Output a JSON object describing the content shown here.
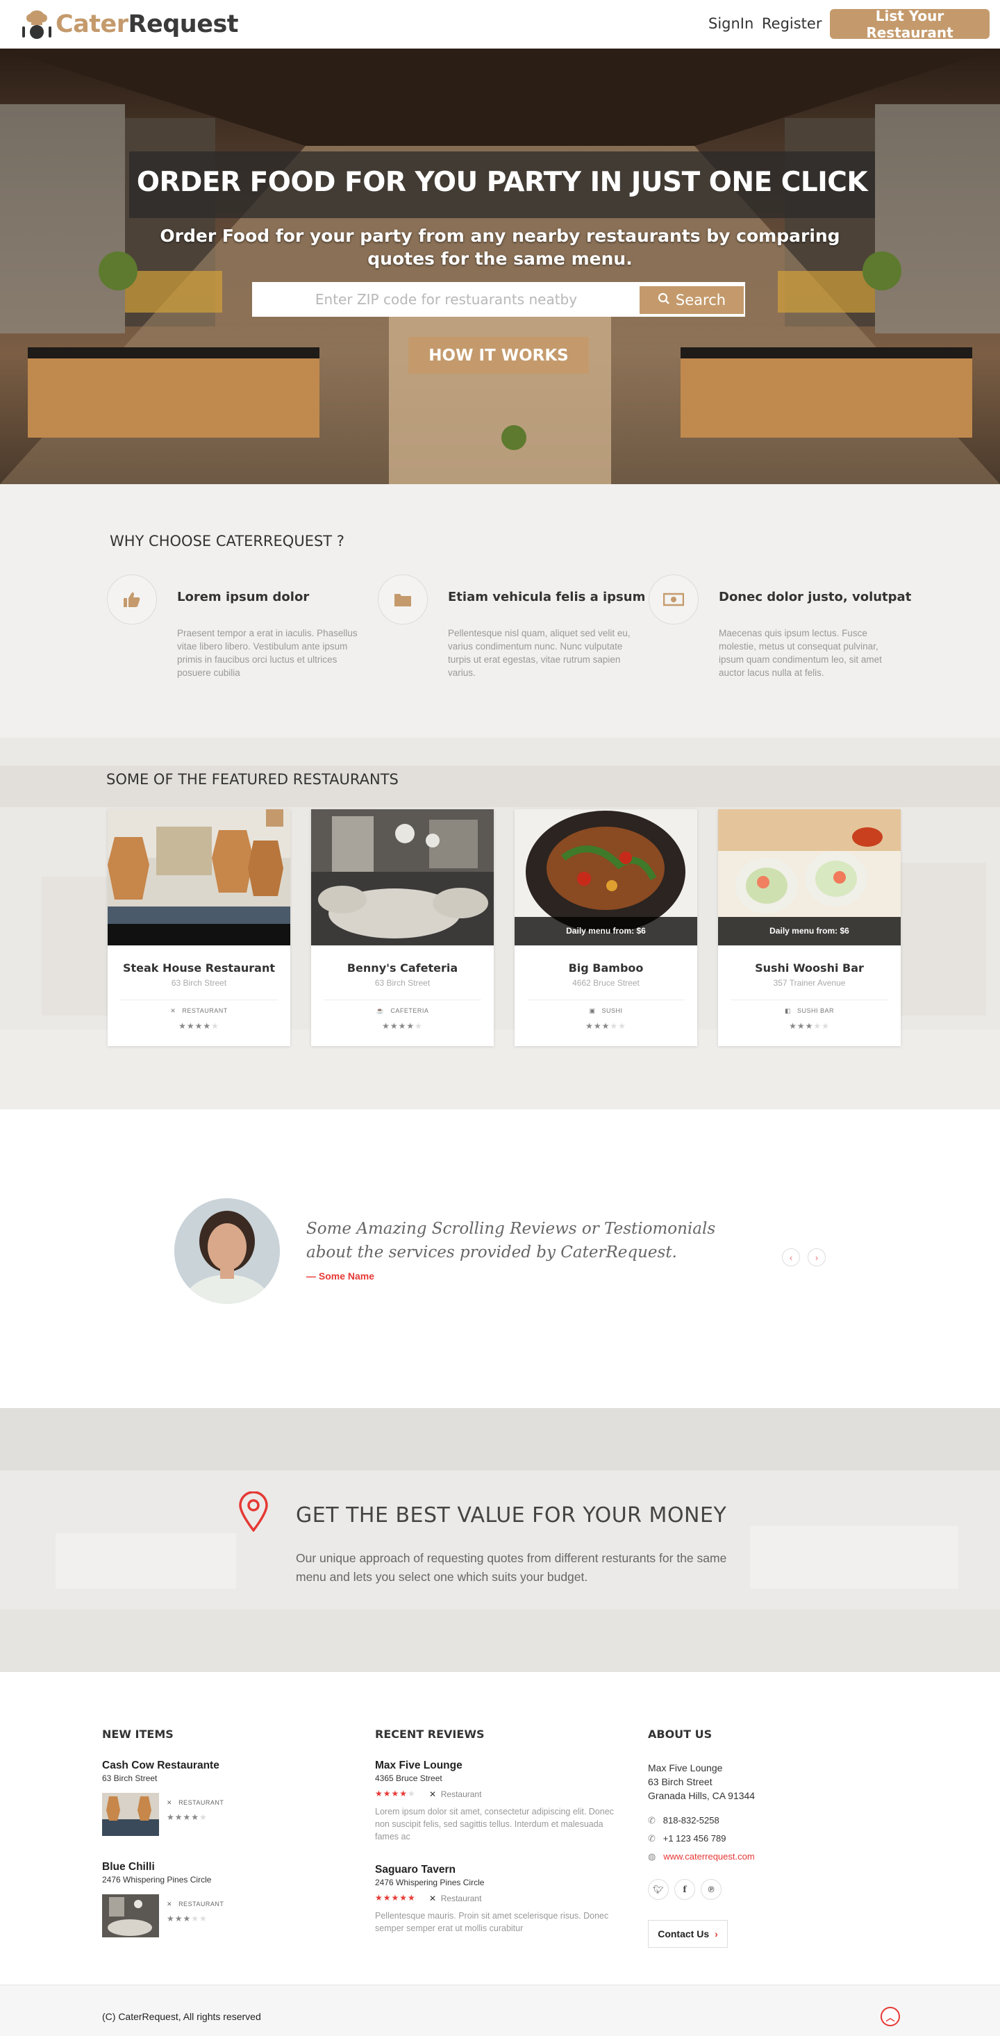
{
  "header": {
    "logo_part1": "Cater",
    "logo_part2": "Request",
    "signin": "SignIn",
    "register": "Register",
    "list_button": "List Your Restaurant"
  },
  "hero": {
    "title": "ORDER FOOD FOR YOU PARTY IN JUST ONE CLICK",
    "subtitle": "Order Food for your party from any nearby restaurants by comparing quotes for the same menu.",
    "search_placeholder": "Enter ZIP code for restuarants neatby",
    "search_button": "Search",
    "how_button": "HOW IT WORKS"
  },
  "why": {
    "heading": "WHY CHOOSE CATERREQUEST ?",
    "features": [
      {
        "icon": "thumbs-up-icon",
        "title": "Lorem ipsum dolor",
        "text": "Praesent tempor a erat in iaculis. Phasellus vitae libero libero. Vestibulum ante ipsum primis in faucibus orci luctus et ultrices posuere cubilia"
      },
      {
        "icon": "folder-icon",
        "title": "Etiam vehicula felis a ipsum",
        "text": "Pellentesque nisl quam, aliquet sed velit eu, varius condimentum nunc. Nunc vulputate turpis ut erat egestas, vitae rutrum sapien varius."
      },
      {
        "icon": "money-icon",
        "title": "Donec dolor justo, volutpat",
        "text": "Maecenas quis ipsum lectus. Fusce molestie, metus ut consequat pulvinar, ipsum quam condimentum leo, sit amet auctor lacus nulla at felis."
      }
    ]
  },
  "featured": {
    "heading": "SOME OF THE FEATURED RESTAURANTS",
    "cards": [
      {
        "name": "Steak House Restaurant",
        "address": "63 Birch Street",
        "category": "RESTAURANT",
        "menu": "",
        "rating": 4
      },
      {
        "name": "Benny's Cafeteria",
        "address": "63 Birch Street",
        "category": "CAFETERIA",
        "menu": "",
        "rating": 4
      },
      {
        "name": "Big Bamboo",
        "address": "4662 Bruce Street",
        "category": "SUSHI",
        "menu": "Daily menu from: $6",
        "rating": 3
      },
      {
        "name": "Sushi Wooshi Bar",
        "address": "357 Trainer Avenue",
        "category": "SUSHI BAR",
        "menu": "Daily menu from: $6",
        "rating": 3
      }
    ]
  },
  "testimonial": {
    "quote": "Some Amazing Scrolling Reviews or Testiomonials about the services provided by CaterRequest.",
    "name": "— Some Name"
  },
  "value": {
    "heading": "GET THE BEST VALUE FOR YOUR MONEY",
    "text": "Our unique approach of requesting quotes from different resturants for the same menu and lets you select one which suits your budget."
  },
  "footer": {
    "new_items_heading": "NEW ITEMS",
    "new_items": [
      {
        "name": "Cash Cow Restaurante",
        "address": "63 Birch Street",
        "category": "RESTAURANT",
        "rating": 4
      },
      {
        "name": "Blue Chilli",
        "address": "2476 Whispering Pines Circle",
        "category": "RESTAURANT",
        "rating": 3
      }
    ],
    "reviews_heading": "RECENT REVIEWS",
    "reviews": [
      {
        "name": "Max Five Lounge",
        "address": "4365 Bruce Street",
        "category": "Restaurant",
        "rating": 4,
        "text": "Lorem ipsum dolor sit amet, consectetur adipiscing elit. Donec non suscipit felis, sed sagittis tellus. Interdum et malesuada fames ac"
      },
      {
        "name": "Saguaro Tavern",
        "address": "2476 Whispering Pines Circle",
        "category": "Restaurant",
        "rating": 5,
        "text": "Pellentesque mauris. Proin sit amet scelerisque risus. Donec semper semper erat ut mollis curabitur"
      }
    ],
    "about_heading": "ABOUT US",
    "about": {
      "line1": "Max Five Lounge",
      "line2": "63 Birch Street",
      "line3": "Granada Hills, CA 91344",
      "phone1": "818-832-5258",
      "phone2": "+1 123 456 789",
      "website": "www.caterrequest.com"
    },
    "contact_button": "Contact Us",
    "copyright": "(C) CaterRequest, All rights reserved"
  },
  "colors": {
    "brand": "#c49a6c",
    "accent_red": "#e53935"
  }
}
